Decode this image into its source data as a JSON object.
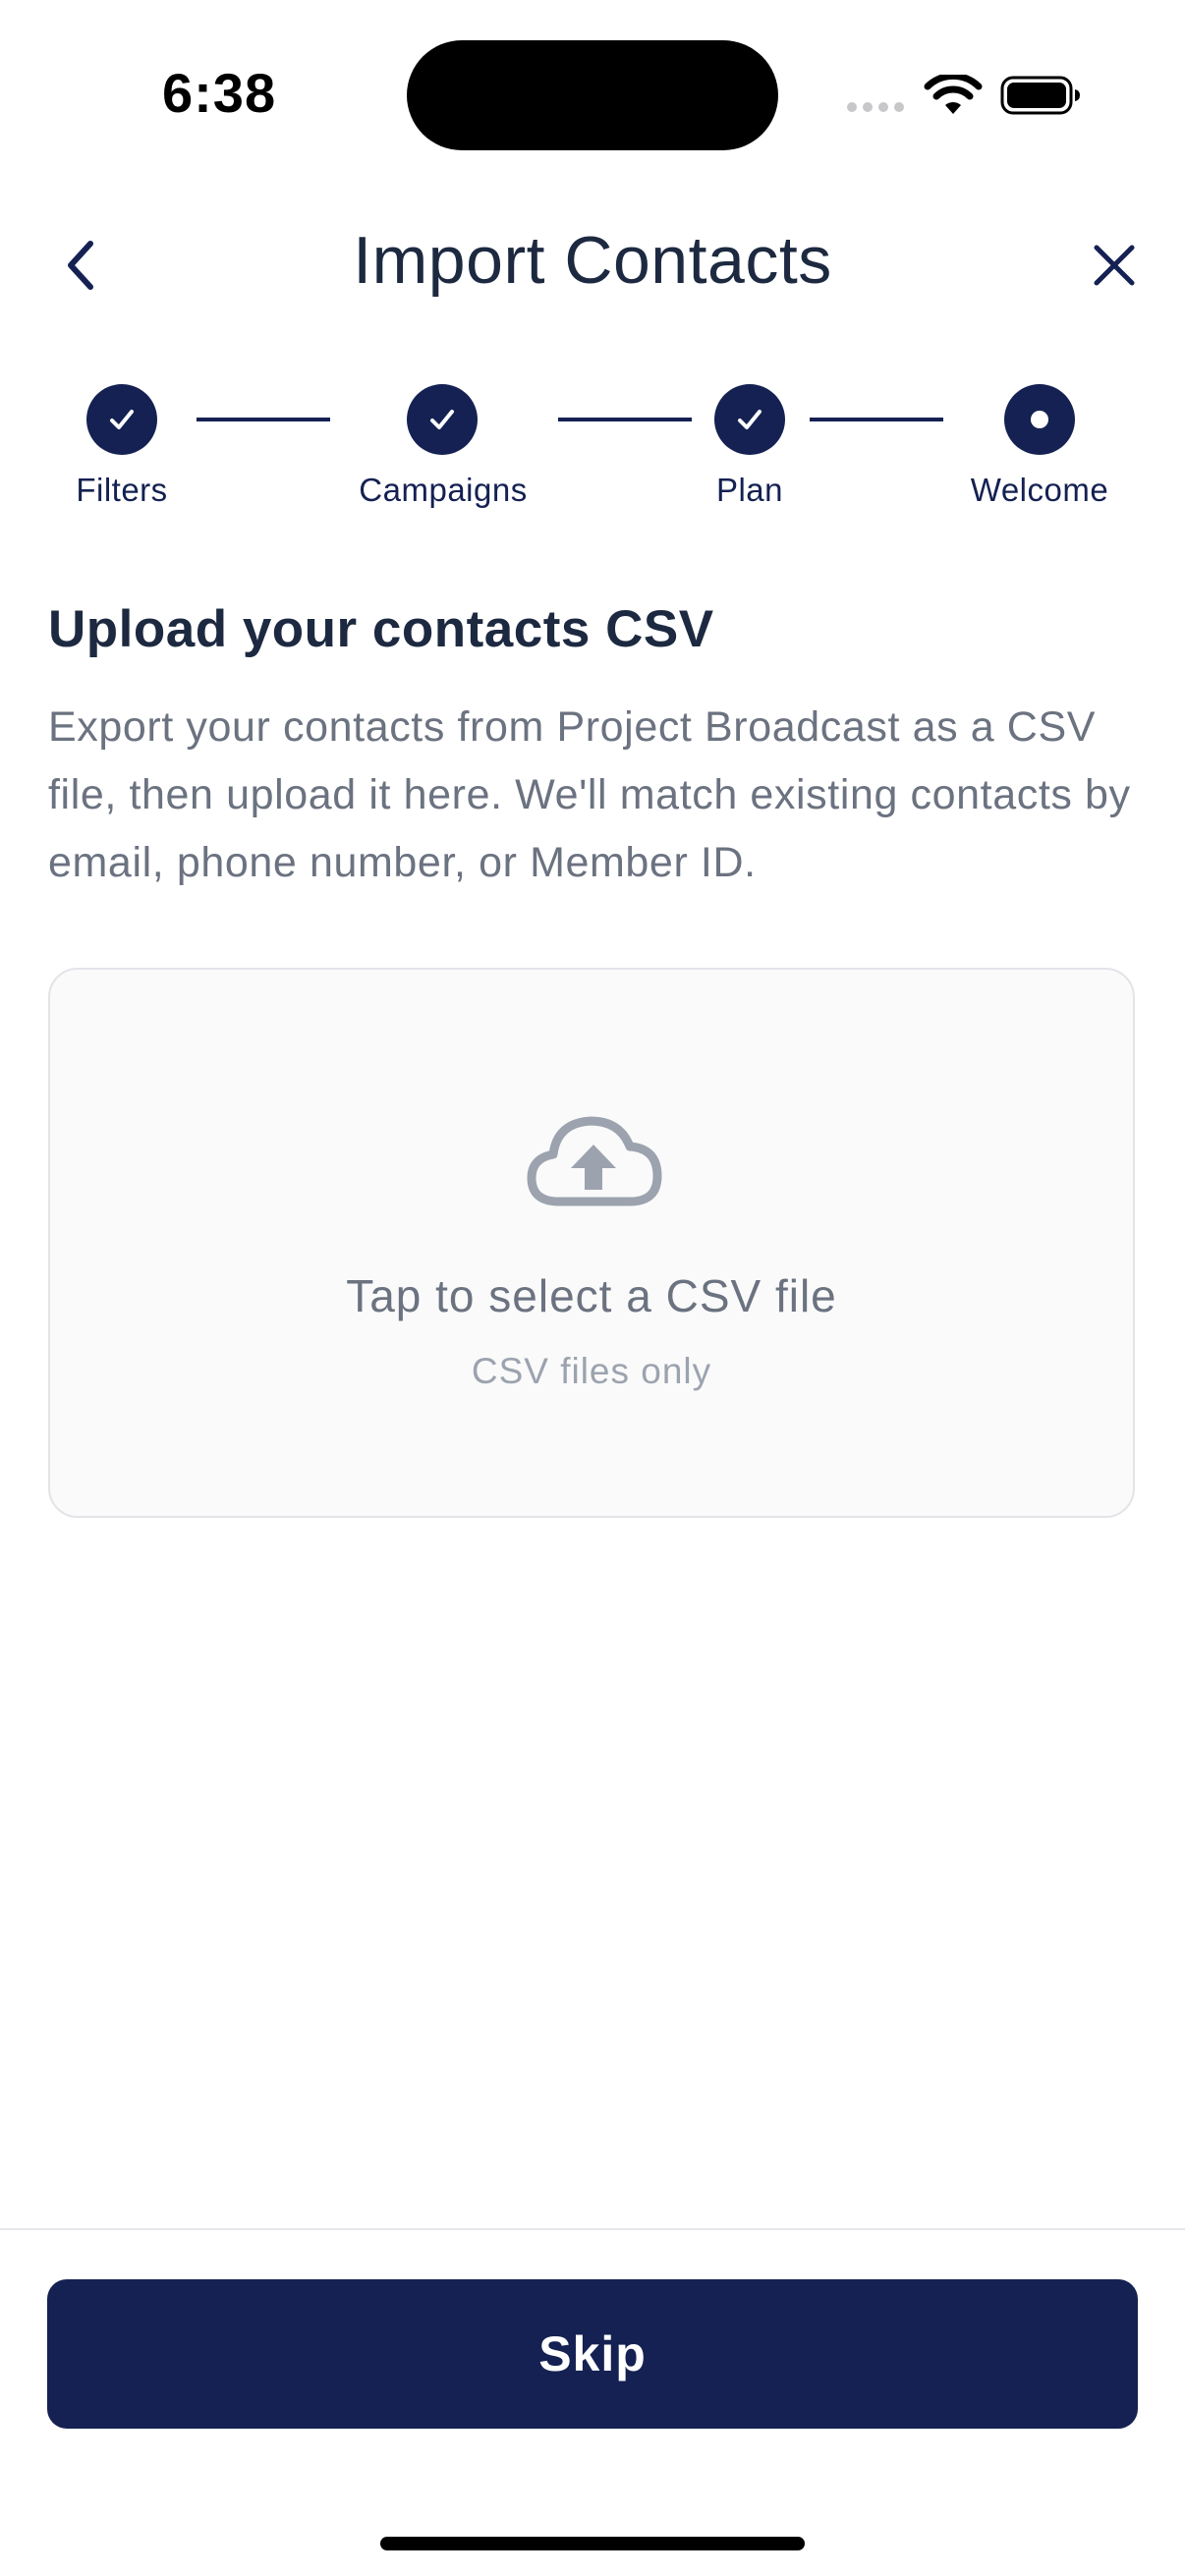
{
  "status_bar": {
    "time": "6:38"
  },
  "header": {
    "title": "Import Contacts",
    "back_icon": "chevron-left-icon",
    "close_icon": "close-icon"
  },
  "stepper": {
    "steps": [
      {
        "label": "Filters",
        "state": "complete"
      },
      {
        "label": "Campaigns",
        "state": "complete"
      },
      {
        "label": "Plan",
        "state": "complete"
      },
      {
        "label": "Welcome",
        "state": "current"
      }
    ]
  },
  "content": {
    "title": "Upload your contacts CSV",
    "description": "Export your contacts from Project Broadcast as a CSV file, then upload it here. We'll match existing contacts by email, phone number, or Member ID."
  },
  "upload": {
    "icon": "cloud-upload-icon",
    "label": "Tap to select a CSV file",
    "hint": "CSV files only"
  },
  "footer": {
    "skip_label": "Skip"
  },
  "colors": {
    "primary": "#142152",
    "text_dark": "#1c2940",
    "text_muted": "#6b7280",
    "text_light": "#9ca3af",
    "upload_bg": "#fafafa",
    "upload_border": "#e3e4e8"
  }
}
